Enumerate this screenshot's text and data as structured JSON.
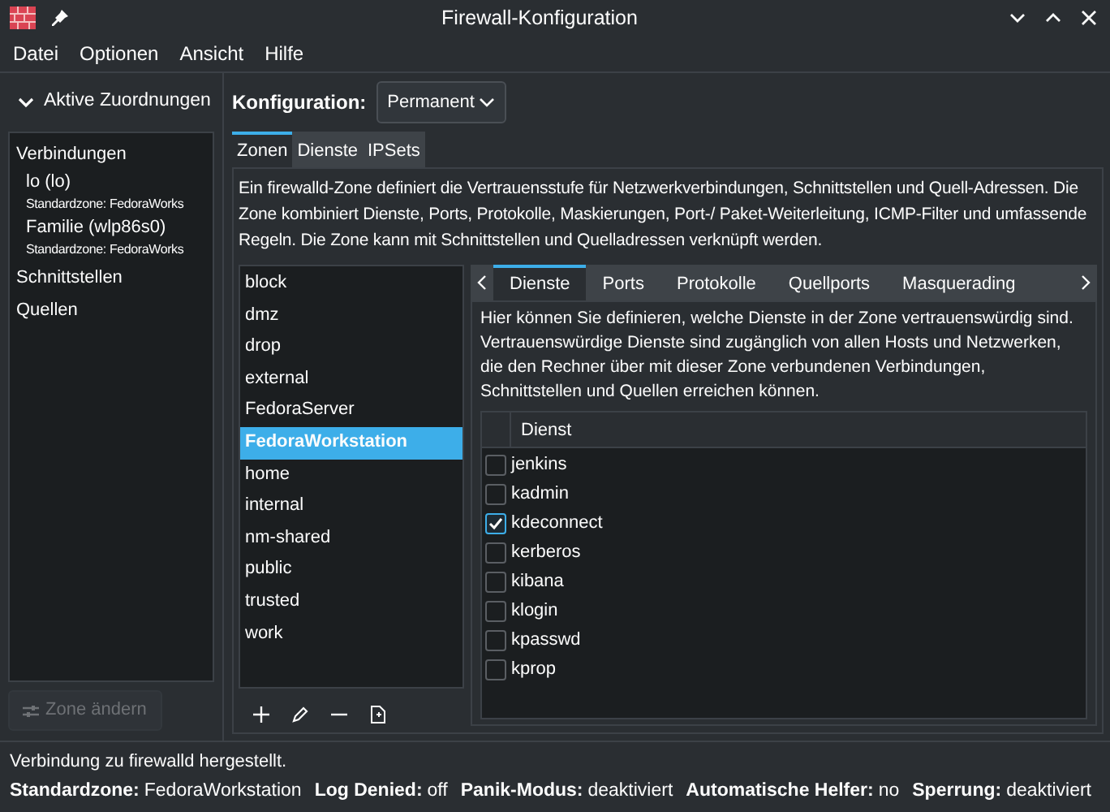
{
  "window": {
    "title": "Firewall-Konfiguration"
  },
  "menu": [
    "Datei",
    "Optionen",
    "Ansicht",
    "Hilfe"
  ],
  "active_bindings": {
    "label": "Aktive Zuordnungen",
    "expanded": true,
    "items": [
      {
        "label": "Verbindungen",
        "children": [
          {
            "label": "lo (lo)",
            "subtitle": "Standardzone: FedoraWorks"
          },
          {
            "label": "Familie (wlp86s0)",
            "subtitle": "Standardzone: FedoraWorks"
          }
        ]
      },
      {
        "label": "Schnittstellen"
      },
      {
        "label": "Quellen"
      }
    ],
    "button": {
      "label": "Zone ändern",
      "disabled": true
    }
  },
  "configuration": {
    "label": "Konfiguration:",
    "value": "Permanent"
  },
  "tabs": [
    {
      "label": "Zonen",
      "selected": true
    },
    {
      "label": "Dienste",
      "selected": false
    },
    {
      "label": "IPSets",
      "selected": false
    }
  ],
  "description": "Ein firewalld-Zone definiert die Vertrauensstufe für Netzwerkverbindungen, Schnittstellen und Quell-Adressen. Die Zone kombiniert Dienste, Ports, Protokolle, Maskierungen, Port-/ Paket-Weiterleitung, ICMP-Filter und umfassende Regeln. Die Zone kann mit Schnittstellen und Quelladressen verknüpft werden.",
  "zones": [
    {
      "label": "block",
      "selected": false
    },
    {
      "label": "dmz",
      "selected": false
    },
    {
      "label": "drop",
      "selected": false
    },
    {
      "label": "external",
      "selected": false
    },
    {
      "label": "FedoraServer",
      "selected": false
    },
    {
      "label": "FedoraWorkstation",
      "selected": true
    },
    {
      "label": "home",
      "selected": false
    },
    {
      "label": "internal",
      "selected": false
    },
    {
      "label": "nm-shared",
      "selected": false
    },
    {
      "label": "public",
      "selected": false
    },
    {
      "label": "trusted",
      "selected": false
    },
    {
      "label": "work",
      "selected": false
    }
  ],
  "zone_tabs": [
    {
      "label": "Dienste",
      "selected": true
    },
    {
      "label": "Ports",
      "selected": false
    },
    {
      "label": "Protokolle",
      "selected": false
    },
    {
      "label": "Quellports",
      "selected": false
    },
    {
      "label": "Masquerading",
      "selected": false
    }
  ],
  "services_description": "Hier können Sie definieren, welche Dienste in der Zone vertrauenswürdig sind. Vertrauenswürdige Dienste sind zugänglich von allen Hosts und Netzwerken, die den Rechner über mit dieser Zone verbundenen Verbindungen, Schnittstellen und Quellen erreichen können.",
  "services_table": {
    "columns": [
      "Dienst"
    ],
    "rows": [
      {
        "name": "jenkins",
        "checked": false
      },
      {
        "name": "kadmin",
        "checked": false
      },
      {
        "name": "kdeconnect",
        "checked": true
      },
      {
        "name": "kerberos",
        "checked": false
      },
      {
        "name": "kibana",
        "checked": false
      },
      {
        "name": "klogin",
        "checked": false
      },
      {
        "name": "kpasswd",
        "checked": false
      },
      {
        "name": "kprop",
        "checked": false
      }
    ]
  },
  "status_message": "Verbindung zu firewalld hergestellt.",
  "status_bar": [
    {
      "label": "Standardzone:",
      "value": "FedoraWorkstation"
    },
    {
      "label": "Log Denied:",
      "value": "off"
    },
    {
      "label": "Panik-Modus:",
      "value": "deaktiviert"
    },
    {
      "label": "Automatische Helfer:",
      "value": "no"
    },
    {
      "label": "Sperrung:",
      "value": "deaktiviert"
    }
  ]
}
